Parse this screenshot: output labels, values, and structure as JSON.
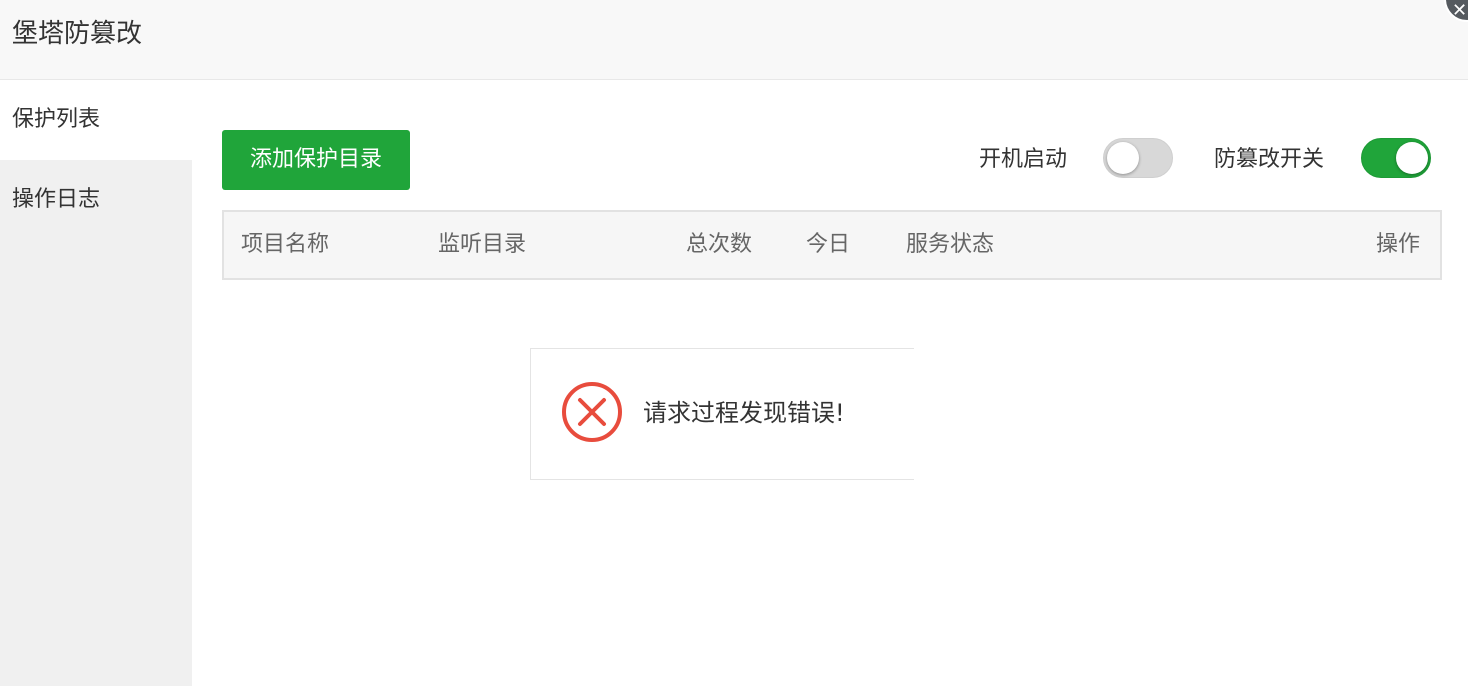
{
  "window": {
    "title": "堡塔防篡改",
    "close_icon": "close-icon"
  },
  "sidebar": {
    "items": [
      {
        "label": "保护列表",
        "active": true
      },
      {
        "label": "操作日志",
        "active": false
      }
    ]
  },
  "toolbar": {
    "add_button_label": "添加保护目录",
    "boot_start_label": "开机启动",
    "boot_start_on": false,
    "tamper_switch_label": "防篡改开关",
    "tamper_switch_on": true
  },
  "table": {
    "columns": [
      "项目名称",
      "监听目录",
      "总次数",
      "今日",
      "服务状态",
      "操作"
    ]
  },
  "error_toast": {
    "message": "请求过程发现错误!",
    "icon": "error-circle-x-icon"
  },
  "colors": {
    "accent": "#20a53a",
    "error": "#e84c3d",
    "sidebar_bg": "#f0f0f0",
    "header_bg": "#f8f8f8"
  }
}
